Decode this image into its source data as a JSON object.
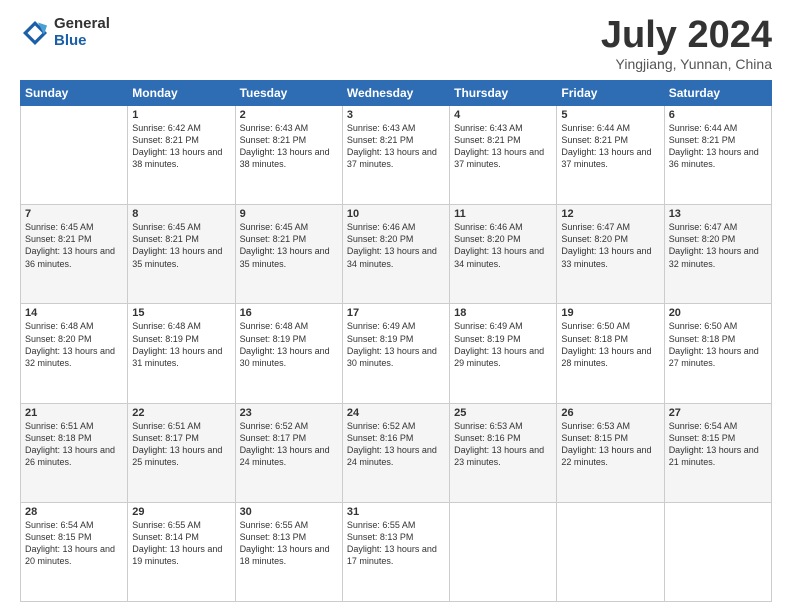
{
  "logo": {
    "general": "General",
    "blue": "Blue"
  },
  "title": "July 2024",
  "location": "Yingjiang, Yunnan, China",
  "weekdays": [
    "Sunday",
    "Monday",
    "Tuesday",
    "Wednesday",
    "Thursday",
    "Friday",
    "Saturday"
  ],
  "weeks": [
    [
      {
        "day": "",
        "sunrise": "",
        "sunset": "",
        "daylight": ""
      },
      {
        "day": "1",
        "sunrise": "Sunrise: 6:42 AM",
        "sunset": "Sunset: 8:21 PM",
        "daylight": "Daylight: 13 hours and 38 minutes."
      },
      {
        "day": "2",
        "sunrise": "Sunrise: 6:43 AM",
        "sunset": "Sunset: 8:21 PM",
        "daylight": "Daylight: 13 hours and 38 minutes."
      },
      {
        "day": "3",
        "sunrise": "Sunrise: 6:43 AM",
        "sunset": "Sunset: 8:21 PM",
        "daylight": "Daylight: 13 hours and 37 minutes."
      },
      {
        "day": "4",
        "sunrise": "Sunrise: 6:43 AM",
        "sunset": "Sunset: 8:21 PM",
        "daylight": "Daylight: 13 hours and 37 minutes."
      },
      {
        "day": "5",
        "sunrise": "Sunrise: 6:44 AM",
        "sunset": "Sunset: 8:21 PM",
        "daylight": "Daylight: 13 hours and 37 minutes."
      },
      {
        "day": "6",
        "sunrise": "Sunrise: 6:44 AM",
        "sunset": "Sunset: 8:21 PM",
        "daylight": "Daylight: 13 hours and 36 minutes."
      }
    ],
    [
      {
        "day": "7",
        "sunrise": "Sunrise: 6:45 AM",
        "sunset": "Sunset: 8:21 PM",
        "daylight": "Daylight: 13 hours and 36 minutes."
      },
      {
        "day": "8",
        "sunrise": "Sunrise: 6:45 AM",
        "sunset": "Sunset: 8:21 PM",
        "daylight": "Daylight: 13 hours and 35 minutes."
      },
      {
        "day": "9",
        "sunrise": "Sunrise: 6:45 AM",
        "sunset": "Sunset: 8:21 PM",
        "daylight": "Daylight: 13 hours and 35 minutes."
      },
      {
        "day": "10",
        "sunrise": "Sunrise: 6:46 AM",
        "sunset": "Sunset: 8:20 PM",
        "daylight": "Daylight: 13 hours and 34 minutes."
      },
      {
        "day": "11",
        "sunrise": "Sunrise: 6:46 AM",
        "sunset": "Sunset: 8:20 PM",
        "daylight": "Daylight: 13 hours and 34 minutes."
      },
      {
        "day": "12",
        "sunrise": "Sunrise: 6:47 AM",
        "sunset": "Sunset: 8:20 PM",
        "daylight": "Daylight: 13 hours and 33 minutes."
      },
      {
        "day": "13",
        "sunrise": "Sunrise: 6:47 AM",
        "sunset": "Sunset: 8:20 PM",
        "daylight": "Daylight: 13 hours and 32 minutes."
      }
    ],
    [
      {
        "day": "14",
        "sunrise": "Sunrise: 6:48 AM",
        "sunset": "Sunset: 8:20 PM",
        "daylight": "Daylight: 13 hours and 32 minutes."
      },
      {
        "day": "15",
        "sunrise": "Sunrise: 6:48 AM",
        "sunset": "Sunset: 8:19 PM",
        "daylight": "Daylight: 13 hours and 31 minutes."
      },
      {
        "day": "16",
        "sunrise": "Sunrise: 6:48 AM",
        "sunset": "Sunset: 8:19 PM",
        "daylight": "Daylight: 13 hours and 30 minutes."
      },
      {
        "day": "17",
        "sunrise": "Sunrise: 6:49 AM",
        "sunset": "Sunset: 8:19 PM",
        "daylight": "Daylight: 13 hours and 30 minutes."
      },
      {
        "day": "18",
        "sunrise": "Sunrise: 6:49 AM",
        "sunset": "Sunset: 8:19 PM",
        "daylight": "Daylight: 13 hours and 29 minutes."
      },
      {
        "day": "19",
        "sunrise": "Sunrise: 6:50 AM",
        "sunset": "Sunset: 8:18 PM",
        "daylight": "Daylight: 13 hours and 28 minutes."
      },
      {
        "day": "20",
        "sunrise": "Sunrise: 6:50 AM",
        "sunset": "Sunset: 8:18 PM",
        "daylight": "Daylight: 13 hours and 27 minutes."
      }
    ],
    [
      {
        "day": "21",
        "sunrise": "Sunrise: 6:51 AM",
        "sunset": "Sunset: 8:18 PM",
        "daylight": "Daylight: 13 hours and 26 minutes."
      },
      {
        "day": "22",
        "sunrise": "Sunrise: 6:51 AM",
        "sunset": "Sunset: 8:17 PM",
        "daylight": "Daylight: 13 hours and 25 minutes."
      },
      {
        "day": "23",
        "sunrise": "Sunrise: 6:52 AM",
        "sunset": "Sunset: 8:17 PM",
        "daylight": "Daylight: 13 hours and 24 minutes."
      },
      {
        "day": "24",
        "sunrise": "Sunrise: 6:52 AM",
        "sunset": "Sunset: 8:16 PM",
        "daylight": "Daylight: 13 hours and 24 minutes."
      },
      {
        "day": "25",
        "sunrise": "Sunrise: 6:53 AM",
        "sunset": "Sunset: 8:16 PM",
        "daylight": "Daylight: 13 hours and 23 minutes."
      },
      {
        "day": "26",
        "sunrise": "Sunrise: 6:53 AM",
        "sunset": "Sunset: 8:15 PM",
        "daylight": "Daylight: 13 hours and 22 minutes."
      },
      {
        "day": "27",
        "sunrise": "Sunrise: 6:54 AM",
        "sunset": "Sunset: 8:15 PM",
        "daylight": "Daylight: 13 hours and 21 minutes."
      }
    ],
    [
      {
        "day": "28",
        "sunrise": "Sunrise: 6:54 AM",
        "sunset": "Sunset: 8:15 PM",
        "daylight": "Daylight: 13 hours and 20 minutes."
      },
      {
        "day": "29",
        "sunrise": "Sunrise: 6:55 AM",
        "sunset": "Sunset: 8:14 PM",
        "daylight": "Daylight: 13 hours and 19 minutes."
      },
      {
        "day": "30",
        "sunrise": "Sunrise: 6:55 AM",
        "sunset": "Sunset: 8:13 PM",
        "daylight": "Daylight: 13 hours and 18 minutes."
      },
      {
        "day": "31",
        "sunrise": "Sunrise: 6:55 AM",
        "sunset": "Sunset: 8:13 PM",
        "daylight": "Daylight: 13 hours and 17 minutes."
      },
      {
        "day": "",
        "sunrise": "",
        "sunset": "",
        "daylight": ""
      },
      {
        "day": "",
        "sunrise": "",
        "sunset": "",
        "daylight": ""
      },
      {
        "day": "",
        "sunrise": "",
        "sunset": "",
        "daylight": ""
      }
    ]
  ]
}
